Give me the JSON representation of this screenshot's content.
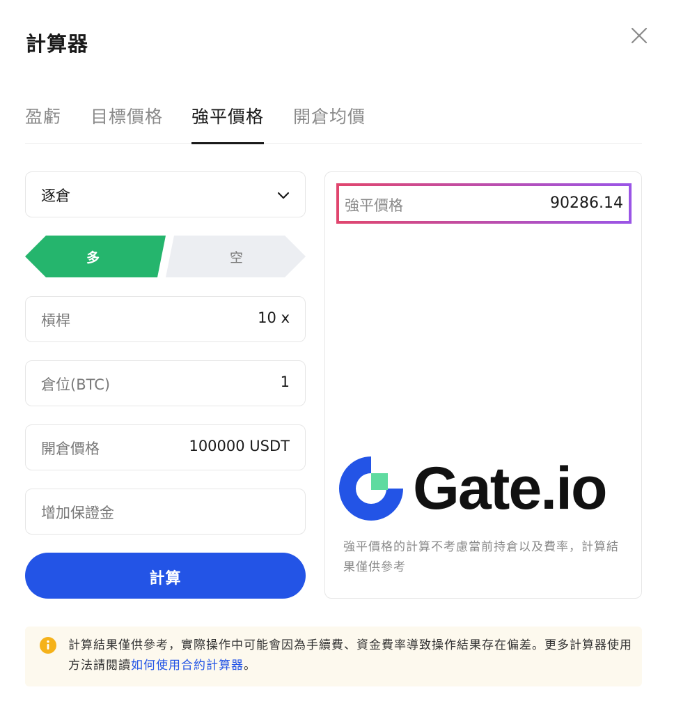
{
  "dialog": {
    "title": "計算器"
  },
  "tabs": [
    {
      "label": "盈虧",
      "active": false
    },
    {
      "label": "目標價格",
      "active": false
    },
    {
      "label": "強平價格",
      "active": true
    },
    {
      "label": "開倉均價",
      "active": false
    }
  ],
  "form": {
    "margin_mode": "逐倉",
    "side_long": "多",
    "side_short": "空",
    "leverage_label": "槓桿",
    "leverage_value": "10 x",
    "position_label": "倉位(BTC)",
    "position_value": "1",
    "open_price_label": "開倉價格",
    "open_price_value": "100000 USDT",
    "add_margin_placeholder": "增加保證金",
    "calculate_label": "計算"
  },
  "result": {
    "label": "強平價格",
    "value": "90286.14",
    "brand": "Gate.io",
    "note": "強平價格的計算不考慮當前持倉以及費率，計算結果僅供參考"
  },
  "footer": {
    "text_before": "計算結果僅供參考，實際操作中可能會因為手續費、資金費率導致操作結果存在偏差。更多計算器使用方法請閱讀",
    "link_text": "如何使用合約計算器",
    "text_after": "。"
  },
  "colors": {
    "long_green": "#25b56d",
    "primary_blue": "#2354e6",
    "gate_blue": "#2354e6",
    "gate_green": "#5fdba0",
    "info_yellow": "#f5b21a"
  },
  "icons": {
    "close": "close-icon",
    "dropdown": "chevron-down-icon",
    "info": "info-icon"
  }
}
